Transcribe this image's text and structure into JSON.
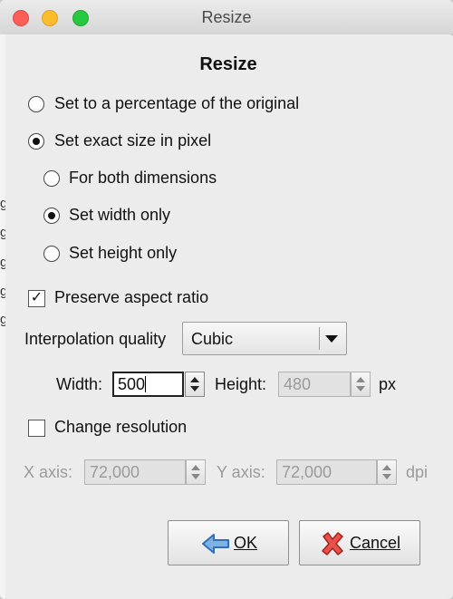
{
  "window": {
    "title": "Resize"
  },
  "dialog": {
    "heading": "Resize"
  },
  "left_edge_fragments": [
    "g",
    "g",
    "g",
    "g",
    "g"
  ],
  "mode_options": [
    {
      "label": "Set to a percentage of the original",
      "selected": false
    },
    {
      "label": "Set exact size in pixel",
      "selected": true
    }
  ],
  "dimension_options": [
    {
      "label": "For both dimensions",
      "selected": false
    },
    {
      "label": "Set width only",
      "selected": true
    },
    {
      "label": "Set height only",
      "selected": false
    }
  ],
  "preserve_aspect": {
    "label": "Preserve aspect ratio",
    "checked": true
  },
  "interpolation": {
    "label": "Interpolation quality",
    "value": "Cubic"
  },
  "size": {
    "width_label": "Width:",
    "width_value": "500",
    "height_label": "Height:",
    "height_value": "480",
    "unit": "px"
  },
  "resolution": {
    "label": "Change resolution",
    "checked": false,
    "x_label": "X axis:",
    "x_value": "72,000",
    "y_label": "Y axis:",
    "y_value": "72,000",
    "unit": "dpi"
  },
  "buttons": {
    "ok": "OK",
    "cancel": "Cancel"
  }
}
